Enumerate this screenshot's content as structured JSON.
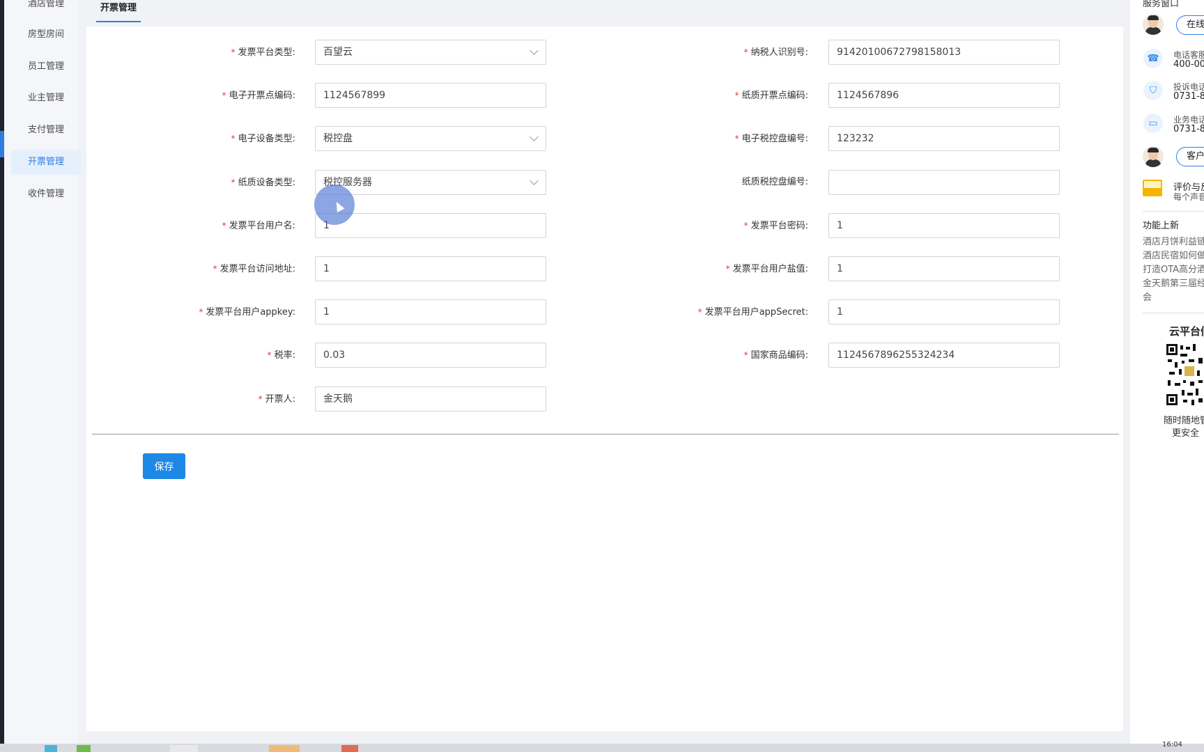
{
  "sidebar": {
    "items": [
      {
        "label": "酒店管理",
        "active": false
      },
      {
        "label": "房型房间",
        "active": false
      },
      {
        "label": "员工管理",
        "active": false
      },
      {
        "label": "业主管理",
        "active": false
      },
      {
        "label": "支付管理",
        "active": false
      },
      {
        "label": "开票管理",
        "active": true
      },
      {
        "label": "收件管理",
        "active": false
      }
    ]
  },
  "tabs": {
    "active_label": "开票管理"
  },
  "form": {
    "left": [
      {
        "label": "发票平台类型:",
        "required": true,
        "type": "select",
        "value": "百望云"
      },
      {
        "label": "电子开票点编码:",
        "required": true,
        "type": "input",
        "value": "1124567899"
      },
      {
        "label": "电子设备类型:",
        "required": true,
        "type": "select",
        "value": "税控盘"
      },
      {
        "label": "纸质设备类型:",
        "required": true,
        "type": "select",
        "value": "税控服务器"
      },
      {
        "label": "发票平台用户名:",
        "required": true,
        "type": "input",
        "value": "1"
      },
      {
        "label": "发票平台访问地址:",
        "required": true,
        "type": "input",
        "value": "1"
      },
      {
        "label": "发票平台用户appkey:",
        "required": true,
        "type": "input",
        "value": "1"
      },
      {
        "label": "税率:",
        "required": true,
        "type": "input",
        "value": "0.03"
      },
      {
        "label": "开票人:",
        "required": true,
        "type": "input",
        "value": "金天鹅"
      }
    ],
    "right": [
      {
        "label": "纳税人识别号:",
        "required": true,
        "type": "input",
        "value": "91420100672798158013"
      },
      {
        "label": "纸质开票点编码:",
        "required": true,
        "type": "input",
        "value": "1124567896"
      },
      {
        "label": "电子税控盘编号:",
        "required": true,
        "type": "input",
        "value": "123232"
      },
      {
        "label": "纸质税控盘编号:",
        "required": false,
        "type": "input",
        "value": ""
      },
      {
        "label": "发票平台密码:",
        "required": true,
        "type": "input",
        "value": "1"
      },
      {
        "label": "发票平台用户盐值:",
        "required": true,
        "type": "input",
        "value": "1"
      },
      {
        "label": "发票平台用户appSecret:",
        "required": true,
        "type": "input",
        "value": "1"
      },
      {
        "label": "国家商品编码:",
        "required": true,
        "type": "input",
        "value": "1124567896255324234"
      }
    ],
    "required_mark": "*",
    "save_label": "保存"
  },
  "right_panel": {
    "title": "服务窗口",
    "online_label": "在线",
    "phone_service_label": "电话客服",
    "phone_service_number": "400-00",
    "complaint_label": "投诉电话",
    "complaint_number": "0731-8",
    "business_label": "业务电话",
    "business_number": "0731-8",
    "customer_label": "客户反",
    "feedback_title": "评价与反",
    "feedback_sub": "每个声音",
    "new_features_title": "功能上新",
    "news": [
      "酒店月饼利益链",
      "酒店民宿如何做",
      "打造OTA高分酒",
      "金天鹅第三届经",
      "会"
    ],
    "cloud_title": "云平台们",
    "qr_caption_1": "随时随地管",
    "qr_caption_2": "更安全"
  },
  "taskbar": {
    "clock": "16:04"
  },
  "colors": {
    "accent": "#2f7de1",
    "required": "#e53935",
    "save": "#1e88e5"
  }
}
